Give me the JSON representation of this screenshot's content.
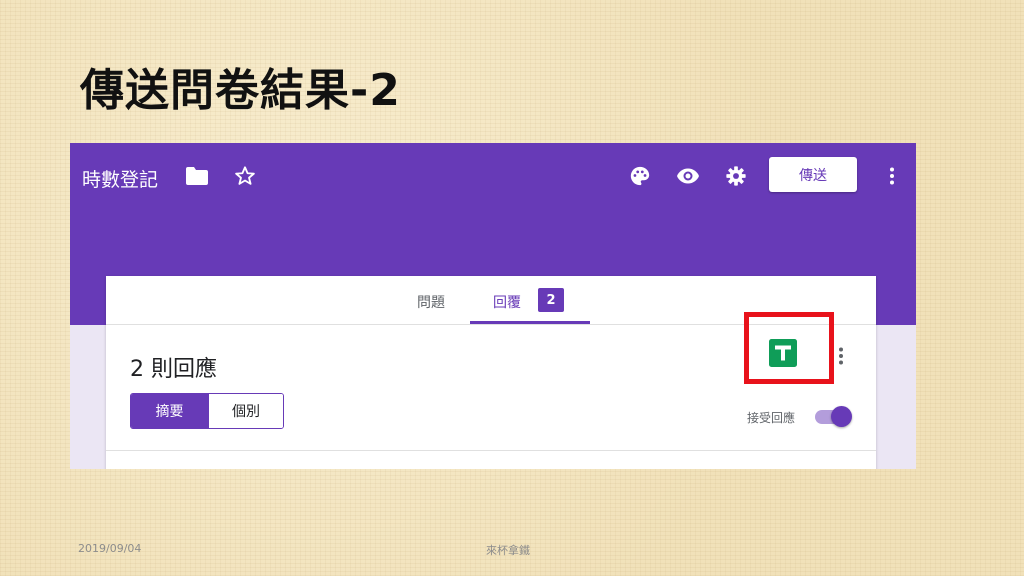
{
  "slide": {
    "title": "傳送問卷結果-2",
    "footer_date": "2019/09/04",
    "footer_center": "來杯拿鐵"
  },
  "topbar": {
    "form_title": "時數登記",
    "icons": [
      "folder-icon",
      "star-icon",
      "palette-icon",
      "eye-icon",
      "gear-icon",
      "more-vert-icon"
    ],
    "send_label": "傳送",
    "color": "#673ab7"
  },
  "tabs": {
    "questions_label": "問題",
    "responses_label": "回覆",
    "responses_count": "2"
  },
  "responses": {
    "count_label": "2 則回應",
    "summary_label": "摘要",
    "individual_label": "個別",
    "accept_label": "接受回應",
    "accepting": true
  },
  "highlight": {
    "target": "sheets-icon",
    "color": "#e8121b"
  }
}
